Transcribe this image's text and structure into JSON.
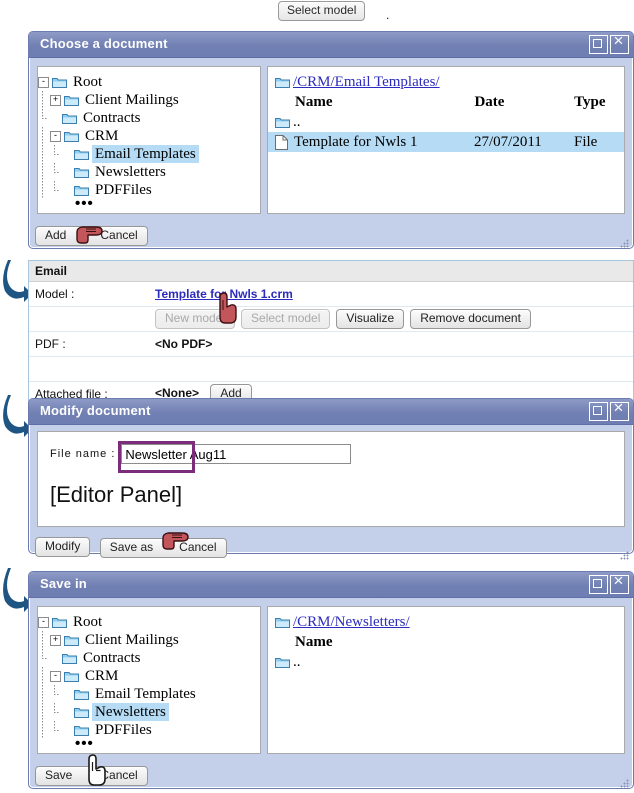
{
  "top": {
    "button_label": "Select model",
    "trailing_text": "."
  },
  "dialog_choose": {
    "title": "Choose a document",
    "controls": {
      "maximize": "maximize-icon",
      "close": "close-icon"
    },
    "tree": [
      {
        "label": "Root",
        "depth": 0,
        "expander": "-",
        "selected": false
      },
      {
        "label": "Client Mailings",
        "depth": 1,
        "expander": "+",
        "selected": false
      },
      {
        "label": "Contracts",
        "depth": 1,
        "expander": "",
        "selected": false
      },
      {
        "label": "CRM",
        "depth": 1,
        "expander": "-",
        "selected": false
      },
      {
        "label": "Email Templates",
        "depth": 2,
        "expander": "",
        "selected": true
      },
      {
        "label": "Newsletters",
        "depth": 2,
        "expander": "",
        "selected": false
      },
      {
        "label": "PDFFiles",
        "depth": 2,
        "expander": "",
        "selected": false
      }
    ],
    "tree_more": "•••",
    "path": "/CRM/Email Templates/",
    "columns": {
      "name": "Name",
      "date": "Date",
      "type": "Type"
    },
    "rows": [
      {
        "name": "..",
        "date": "",
        "type": "",
        "kind": "folder",
        "selected": false
      },
      {
        "name": "Template for Nwls 1",
        "date": "27/07/2011",
        "type": "File",
        "kind": "file",
        "selected": true
      }
    ],
    "footer": {
      "add": "Add",
      "cancel": "Cancel"
    }
  },
  "info_panel": {
    "header": "Email",
    "model_label": "Model :",
    "model_value": "Template for Nwls 1.crm",
    "buttons": [
      {
        "label": "New model",
        "disabled": true
      },
      {
        "label": "Select model",
        "disabled": true
      },
      {
        "label": "Visualize",
        "disabled": false
      },
      {
        "label": "Remove document",
        "disabled": false
      }
    ],
    "pdf_label": "PDF :",
    "pdf_value": "<No PDF>",
    "attached_label": "Attached file :",
    "attached_value": "<None>",
    "attached_button": "Add"
  },
  "dialog_modify": {
    "title": "Modify document",
    "filename_label": "File name :",
    "filename_value": "Newsletter Aug11",
    "filename_placeholder": "",
    "editor_placeholder": "[Editor Panel]",
    "footer": {
      "modify": "Modify",
      "save_as": "Save as",
      "cancel": "Cancel"
    }
  },
  "dialog_save": {
    "title": "Save in",
    "tree": [
      {
        "label": "Root",
        "depth": 0,
        "expander": "-",
        "selected": false
      },
      {
        "label": "Client Mailings",
        "depth": 1,
        "expander": "+",
        "selected": false
      },
      {
        "label": "Contracts",
        "depth": 1,
        "expander": "",
        "selected": false
      },
      {
        "label": "CRM",
        "depth": 1,
        "expander": "-",
        "selected": false
      },
      {
        "label": "Email Templates",
        "depth": 2,
        "expander": "",
        "selected": false
      },
      {
        "label": "Newsletters",
        "depth": 2,
        "expander": "",
        "selected": true
      },
      {
        "label": "PDFFiles",
        "depth": 2,
        "expander": "",
        "selected": false
      }
    ],
    "tree_more": "•••",
    "path": "/CRM/Newsletters/",
    "columns": {
      "name": "Name"
    },
    "rows": [
      {
        "name": "..",
        "kind": "folder",
        "selected": false
      }
    ],
    "footer": {
      "save": "Save",
      "cancel": "Cancel"
    }
  },
  "colors": {
    "titlebar": "#7180b3",
    "dialog_body": "#c4cfe9",
    "selection": "#b5dcf4",
    "link": "#2b2bbd",
    "highlight_box": "#7b2d7b",
    "flow_arrow": "#1f5582"
  }
}
